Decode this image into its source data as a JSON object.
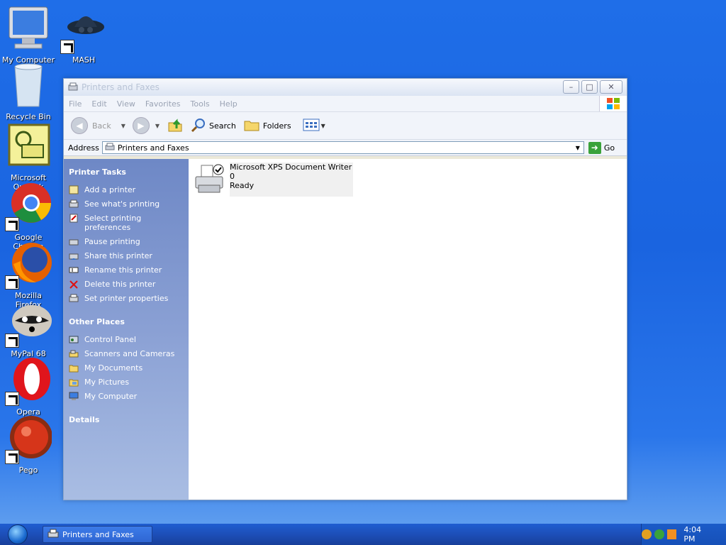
{
  "desktop": {
    "icons": [
      {
        "label": "My Computer"
      },
      {
        "label": "MASH"
      },
      {
        "label": "Recycle Bin"
      },
      {
        "label": "Microsoft Outlook"
      },
      {
        "label": "Google Chrome"
      },
      {
        "label": "Mozilla Firefox"
      },
      {
        "label": "MyPal 68"
      },
      {
        "label": "Opera"
      },
      {
        "label": "Pego"
      }
    ]
  },
  "window": {
    "title": "Printers and Faxes",
    "controls": {
      "minimize": "–",
      "maximize": "□",
      "close": "✕"
    },
    "menu": [
      "File",
      "Edit",
      "View",
      "Favorites",
      "Tools",
      "Help"
    ],
    "toolbar": {
      "back": "Back",
      "search": "Search",
      "folders": "Folders"
    },
    "address": {
      "label": "Address",
      "value": "Printers and Faxes",
      "go": "Go"
    },
    "tasks": {
      "printer_tasks": {
        "title": "Printer Tasks",
        "items": [
          "Add a printer",
          "See what's printing",
          "Select printing preferences",
          "Pause printing",
          "Share this printer",
          "Rename this printer",
          "Delete this printer",
          "Set printer properties"
        ]
      },
      "other_places": {
        "title": "Other Places",
        "items": [
          "Control Panel",
          "Scanners and Cameras",
          "My Documents",
          "My Pictures",
          "My Computer"
        ]
      },
      "details": {
        "title": "Details"
      }
    },
    "printers": [
      {
        "name": "Microsoft XPS Document Writer",
        "docs": "0",
        "status": "Ready"
      }
    ]
  },
  "taskbar": {
    "task": "Printers and Faxes",
    "clock": "4:04 PM"
  }
}
